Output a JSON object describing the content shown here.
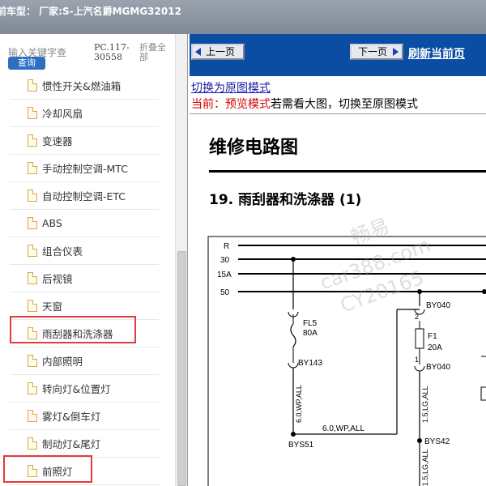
{
  "titlebar": {
    "text": "前车型： 厂家:S-上汽名爵MGMG32012"
  },
  "search": {
    "keyword_placeholder": "输入关键字查",
    "query_button": "查询",
    "pc_code": "PC.117-30558",
    "collapse_all": "折叠全部"
  },
  "tree": {
    "items": [
      {
        "label": "惯性开关&燃油箱"
      },
      {
        "label": "冷却风扇"
      },
      {
        "label": "变速器"
      },
      {
        "label": "手动控制空调-MTC"
      },
      {
        "label": "自动控制空调-ETC"
      },
      {
        "label": "ABS"
      },
      {
        "label": "组合仪表"
      },
      {
        "label": "后视镜"
      },
      {
        "label": "天窗"
      },
      {
        "label": "雨刮器和洗涤器"
      },
      {
        "label": "内部照明"
      },
      {
        "label": "转向灯&位置灯"
      },
      {
        "label": "雾灯&倒车灯"
      },
      {
        "label": "制动灯&尾灯"
      },
      {
        "label": "前照灯"
      }
    ]
  },
  "nav": {
    "prev": "上一页",
    "next": "下一页",
    "refresh": "刷新当前页"
  },
  "viewer": {
    "switch_link": "切换为原图模式",
    "current_label": "当前：",
    "current_mode": "预览模式",
    "current_hint": "若需看大图，切换至原图模式",
    "doc_title": "维修电路图",
    "section_title": "19.  雨刮器和洗涤器 (1)"
  },
  "diagram": {
    "rails": [
      "R",
      "30",
      "15A",
      "50"
    ],
    "fuse_fl5": "FL5",
    "fuse_fl5_rating": "80A",
    "fuse_f1": "F1",
    "fuse_f1_rating": "20A",
    "conn_by143": "BY143",
    "conn_by040_top": "BY040",
    "conn_by040_bot": "BY040",
    "pin_2": "2",
    "pin_1": "1",
    "wire_6wp": "6.0,WP,ALL",
    "wire_6wp_h": "6.0,WP,ALL",
    "wire_15lg_a": "1.5,LG,ALL",
    "wire_15lg_b": "1.5,LG,ALL",
    "splice_bys51": "BYS51",
    "splice_bys42": "BYS42"
  },
  "watermark": {
    "line1": "畅易",
    "line2": "car388.com",
    "line3": "CY20165"
  }
}
